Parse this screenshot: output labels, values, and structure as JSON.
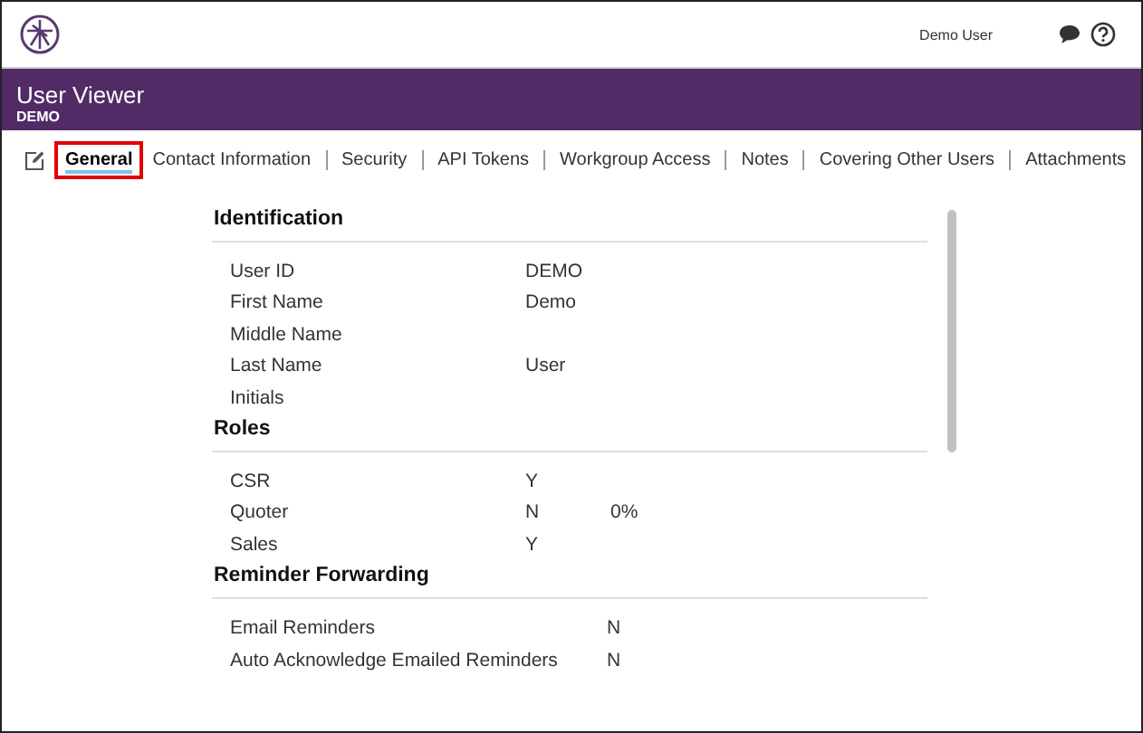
{
  "header": {
    "user": "Demo User"
  },
  "title_bar": {
    "title": "User Viewer",
    "subtitle": "DEMO"
  },
  "tabs": [
    {
      "label": "General",
      "selected": true
    },
    {
      "label": "Contact Information",
      "selected": false
    },
    {
      "label": "Security",
      "selected": false
    },
    {
      "label": "API Tokens",
      "selected": false
    },
    {
      "label": "Workgroup Access",
      "selected": false
    },
    {
      "label": "Notes",
      "selected": false
    },
    {
      "label": "Covering Other Users",
      "selected": false
    },
    {
      "label": "Attachments",
      "selected": false
    }
  ],
  "sections": [
    {
      "title": "Identification",
      "rows": [
        {
          "label": "User ID",
          "value": "DEMO"
        },
        {
          "label": "First Name",
          "value": "Demo"
        },
        {
          "label": "Middle Name"
        },
        {
          "label": "Last Name",
          "value": "User"
        },
        {
          "label": "Initials"
        }
      ]
    },
    {
      "title": "Roles",
      "rows": [
        {
          "label": "CSR",
          "value": "Y"
        },
        {
          "label": "Quoter",
          "value": "N",
          "extra": "0%"
        },
        {
          "label": "Sales",
          "value": "Y"
        }
      ]
    },
    {
      "title": "Reminder Forwarding",
      "rows": [
        {
          "label": "Email Reminders",
          "value": "N"
        },
        {
          "label": "Auto Acknowledge Emailed Reminders",
          "value": "N"
        }
      ]
    }
  ]
}
